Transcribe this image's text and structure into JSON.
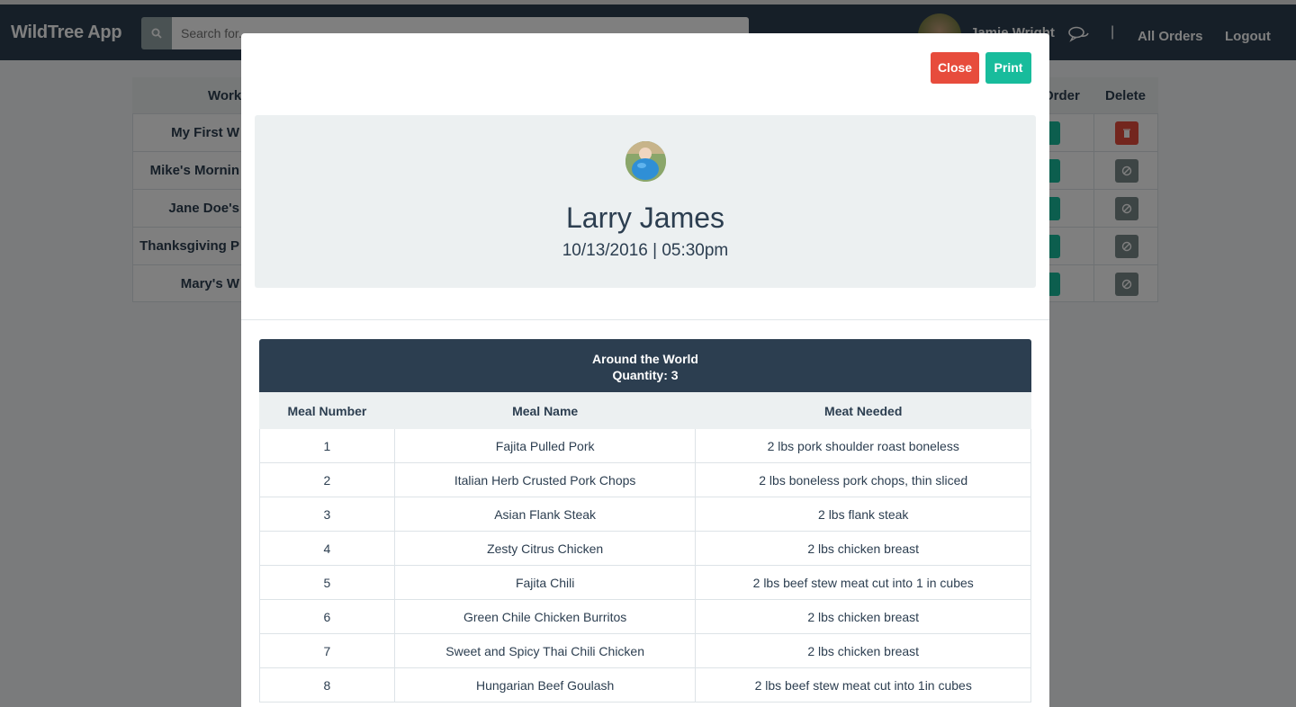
{
  "navbar": {
    "brand": "WildTree App",
    "search_placeholder": "Search for...",
    "user_name": "Jamie Wright",
    "separator": "|",
    "all_orders": "All Orders",
    "logout": "Logout"
  },
  "background_table": {
    "headers": {
      "work": "Work",
      "order": "Order",
      "delete": "Delete"
    },
    "rows": [
      {
        "name": "My First W"
      },
      {
        "name": "Mike's Mornin"
      },
      {
        "name": "Jane Doe's"
      },
      {
        "name": "Thanksgiving P"
      },
      {
        "name": "Mary's W"
      }
    ]
  },
  "modal": {
    "close_label": "Close",
    "print_label": "Print",
    "customer_name": "Larry James",
    "datetime": "10/13/2016 | 05:30pm",
    "package": {
      "title": "Around the World",
      "quantity": "Quantity: 3"
    },
    "table": {
      "headers": [
        "Meal Number",
        "Meal Name",
        "Meat Needed"
      ],
      "rows": [
        [
          "1",
          "Fajita Pulled Pork",
          "2 lbs pork shoulder roast boneless"
        ],
        [
          "2",
          "Italian Herb Crusted Pork Chops",
          "2 lbs boneless pork chops, thin sliced"
        ],
        [
          "3",
          "Asian Flank Steak",
          "2 lbs flank steak"
        ],
        [
          "4",
          "Zesty Citrus Chicken",
          "2 lbs chicken breast"
        ],
        [
          "5",
          "Fajita Chili",
          "2 lbs beef stew meat cut into 1 in cubes"
        ],
        [
          "6",
          "Green Chile Chicken Burritos",
          "2 lbs chicken breast"
        ],
        [
          "7",
          "Sweet and Spicy Thai Chili Chicken",
          "2 lbs chicken breast"
        ],
        [
          "8",
          "Hungarian Beef Goulash",
          "2 lbs beef stew meat cut into 1in cubes"
        ]
      ]
    }
  },
  "colors": {
    "navbar": "#2c3e50",
    "danger": "#e74c3c",
    "success": "#18bc9c",
    "light": "#ecf0f1"
  },
  "icons": [
    "search-icon",
    "chat-icon",
    "trash-icon",
    "ban-icon",
    "avatar"
  ]
}
